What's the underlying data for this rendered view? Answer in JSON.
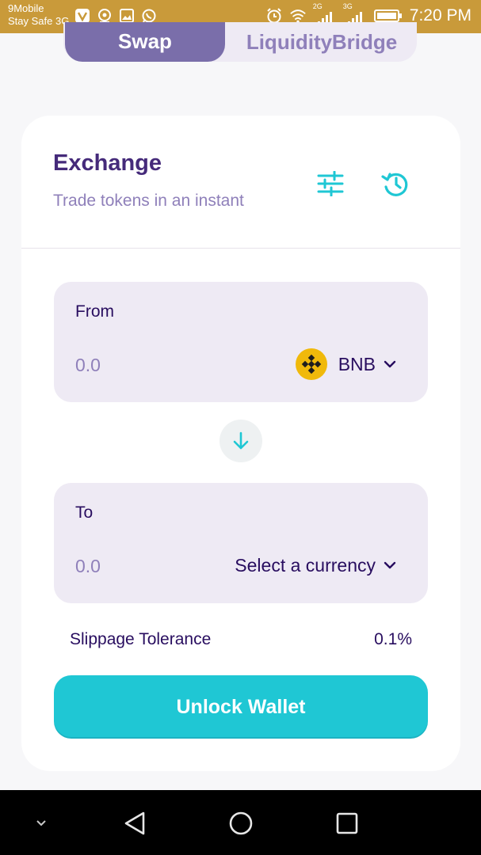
{
  "status_bar": {
    "carrier": "9Mobile",
    "network_name": "Stay Safe 3G",
    "time": "7:20 PM",
    "net_badge_1": "2G",
    "net_badge_2": "3G",
    "notification_icons": [
      "vpn-icon",
      "data-saver-icon",
      "image-icon",
      "whatsapp-icon"
    ],
    "status_icons": [
      "alarm-icon",
      "wifi-icon",
      "signal-icon",
      "signal-icon",
      "battery-icon"
    ]
  },
  "tabs": [
    {
      "label": "Swap",
      "active": true
    },
    {
      "label": "Liquidity",
      "active": false
    },
    {
      "label": "Bridge",
      "active": false
    }
  ],
  "exchange": {
    "title": "Exchange",
    "subtitle": "Trade tokens in an instant",
    "settings_icon": "settings-sliders-icon",
    "history_icon": "history-icon"
  },
  "from": {
    "label": "From",
    "placeholder": "0.0",
    "currency": "BNB",
    "currency_icon": "bnb-logo"
  },
  "to": {
    "label": "To",
    "placeholder": "0.0",
    "currency": "Select a currency"
  },
  "slippage": {
    "label": "Slippage Tolerance",
    "value": "0.1%"
  },
  "unlock_button": "Unlock Wallet",
  "colors": {
    "primary": "#1fc7d4",
    "secondary": "#7a6eaa",
    "text": "#280d5f",
    "title": "#452a7a",
    "input_bg": "#eeeaf4",
    "status_bar": "#c99a3a",
    "bnb": "#f0b90b"
  },
  "nav_bar": {
    "buttons": [
      "chevron-down-icon",
      "back-icon",
      "home-icon",
      "recents-icon"
    ]
  }
}
